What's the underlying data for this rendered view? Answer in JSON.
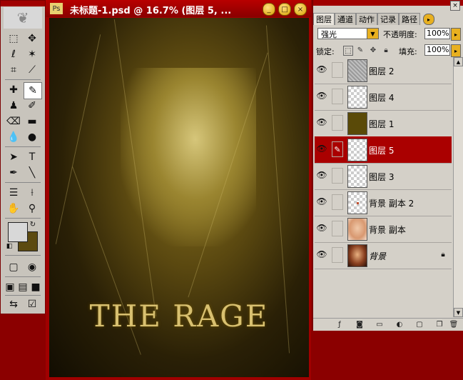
{
  "document": {
    "title": "未标题-1.psd @ 16.7% (图层 5, ...",
    "window_buttons": {
      "minimize": "_",
      "maximize": "□",
      "close": "×"
    },
    "poster_text": "THE RAGE"
  },
  "toolbox": {
    "foreground_color": "#d8d8d8",
    "background_color": "#5c4a10"
  },
  "layers_panel": {
    "tabs": [
      "图层",
      "通道",
      "动作",
      "记录",
      "路径"
    ],
    "blend_mode": "强光",
    "opacity_label": "不透明度:",
    "opacity_value": "100%",
    "lock_label": "锁定:",
    "fill_label": "填充:",
    "fill_value": "100%",
    "layers": [
      {
        "name": "图层 2",
        "thumb": "noise",
        "selected": false
      },
      {
        "name": "图层 4",
        "thumb": "checker",
        "selected": false
      },
      {
        "name": "图层 1",
        "thumb": "#5a4a08",
        "selected": false
      },
      {
        "name": "图层 5",
        "thumb": "checker",
        "selected": true
      },
      {
        "name": "图层 3",
        "thumb": "checker",
        "selected": false
      },
      {
        "name": "背景 副本 2",
        "thumb": "checker-dot",
        "selected": false
      },
      {
        "name": "背景 副本",
        "thumb": "face-light",
        "selected": false
      },
      {
        "name": "背景",
        "thumb": "face",
        "selected": false
      }
    ]
  },
  "colors": {
    "title_bar": "#a00000",
    "selected_layer": "#aa0000"
  }
}
